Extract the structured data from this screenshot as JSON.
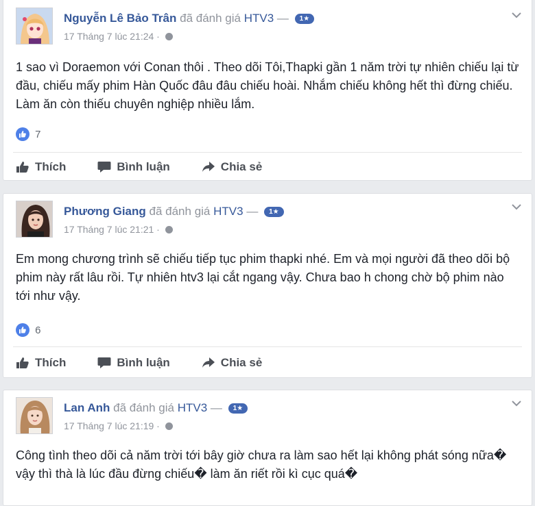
{
  "colors": {
    "page_background": "#e9ebee",
    "card_background": "#ffffff",
    "link_blue": "#365899",
    "meta_gray": "#90949c",
    "badge_blue": "#4267b2",
    "like_blue": "#4e80e8"
  },
  "posts": [
    {
      "author": "Nguyễn Lê Bảo Trân",
      "verb": "đã đánh giá",
      "page": "HTV3",
      "dash": "—",
      "rating_badge": "1★",
      "timestamp": "17 Tháng 7 lúc 21:24 ·",
      "text": "1 sao vì Doraemon với Conan thôi . Theo dõi Tôi,Thapki gần 1 năm trời tự nhiên chiếu lại từ đầu, chiếu mấy phim Hàn Quốc đâu đâu chiếu hoài. Nhắm chiếu không hết thì đừng chiếu. Làm ăn còn thiếu chuyên nghiệp nhiều lắm.",
      "like_count": "7",
      "avatar_icon": "anime-girl-avatar"
    },
    {
      "author": "Phương Giang",
      "verb": "đã đánh giá",
      "page": "HTV3",
      "dash": "—",
      "rating_badge": "1★",
      "timestamp": "17 Tháng 7 lúc 21:21 ·",
      "text": "Em mong chương trình sẽ chiếu tiếp tục phim thapki nhé. Em và mọi người đã theo dõi bộ phim này rất lâu rồi. Tự nhiên htv3 lại cắt ngang vậy. Chưa bao h chong chờ bộ phim nào tới như vậy.",
      "like_count": "6",
      "avatar_icon": "woman-photo-avatar"
    },
    {
      "author": "Lan Anh",
      "verb": "đã đánh giá",
      "page": "HTV3",
      "dash": "—",
      "rating_badge": "1★",
      "timestamp": "17 Tháng 7 lúc 21:19 ·",
      "text": "Công tình theo dõi cả năm trời tới bây giờ chưa ra làm sao hết lại không phát sóng nữa� vậy thì thà là lúc đầu đừng chiếu� làm ăn riết rồi kì cục quá�",
      "avatar_icon": "woman-photo-avatar"
    }
  ],
  "actions": {
    "like": "Thích",
    "comment": "Bình luận",
    "share": "Chia sẻ"
  }
}
